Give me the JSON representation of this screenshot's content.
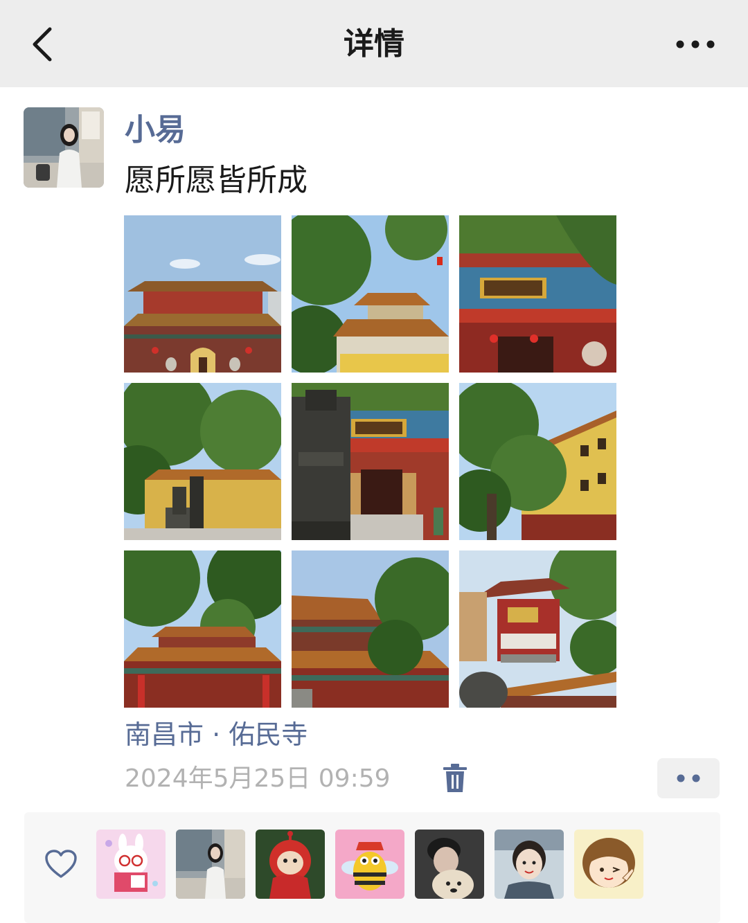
{
  "header": {
    "title": "详情",
    "back_icon": "chevron-left-icon",
    "more_icon": "ellipsis-icon"
  },
  "post": {
    "author": "小易",
    "text": "愿所愿皆所成",
    "photo_count": 9,
    "location": "南昌市 · 佑民寺",
    "timestamp": "2024年5月25日 09:59",
    "delete_icon": "trash-icon",
    "action_icon": "two-dots-icon"
  },
  "likes": {
    "icon": "heart-icon",
    "liker_count": 7
  },
  "colors": {
    "header_bg": "#ededed",
    "link_blue": "#576b95",
    "timestamp_gray": "#b2b2b2",
    "panel_bg": "#f7f7f7"
  }
}
